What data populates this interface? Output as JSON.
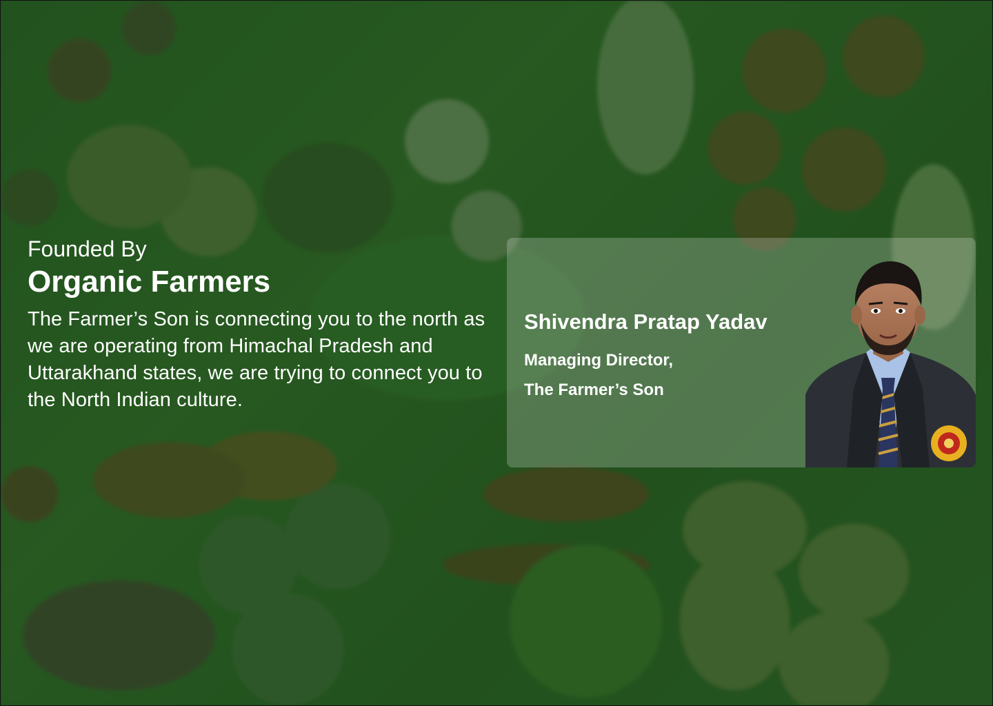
{
  "intro": {
    "eyebrow": "Founded By",
    "headline": "Organic Farmers",
    "body": "The Farmer’s Son is connecting you to the north as we are operating from Himachal Pradesh and Uttarakhand states, we are trying to connect you to the North Indian culture."
  },
  "founder": {
    "name": "Shivendra Pratap Yadav",
    "title": "Managing Director,",
    "company": "The  Farmer’s Son",
    "photo_icon": "founder-portrait"
  },
  "colors": {
    "overlay": "#1e501c",
    "text": "#ffffff",
    "card": "#ffffff"
  }
}
